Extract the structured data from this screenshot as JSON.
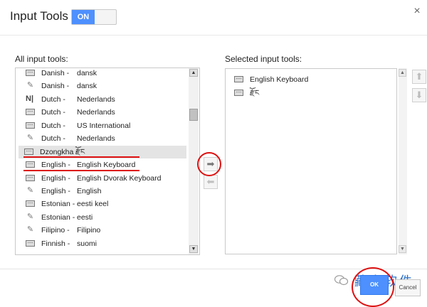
{
  "header": {
    "title": "Input Tools",
    "toggle_label": "ON",
    "close_icon": "×"
  },
  "available": {
    "label": "All input tools:",
    "items": [
      {
        "icon": "keyboard-icon",
        "lang": "Danish -",
        "name": "dansk"
      },
      {
        "icon": "pencil-icon",
        "lang": "Danish -",
        "name": "dansk"
      },
      {
        "icon": "bars-icon",
        "lang": "Dutch -",
        "name": "Nederlands"
      },
      {
        "icon": "keyboard-icon",
        "lang": "Dutch -",
        "name": "Nederlands"
      },
      {
        "icon": "keyboard-icon",
        "lang": "Dutch -",
        "name": "US International"
      },
      {
        "icon": "pencil-icon",
        "lang": "Dutch -",
        "name": "Nederlands"
      },
      {
        "icon": "keyboard-icon",
        "lang": "Dzongkha -",
        "name": "རྫོང"
      },
      {
        "icon": "keyboard-icon",
        "lang": "English -",
        "name": "English Keyboard"
      },
      {
        "icon": "keyboard-icon",
        "lang": "English -",
        "name": "English Dvorak Keyboard"
      },
      {
        "icon": "pencil-icon",
        "lang": "English -",
        "name": "English"
      },
      {
        "icon": "keyboard-icon",
        "lang": "Estonian -",
        "name": "eesti keel"
      },
      {
        "icon": "pencil-icon",
        "lang": "Estonian -",
        "name": "eesti"
      },
      {
        "icon": "pencil-icon",
        "lang": "Filipino -",
        "name": "Filipino"
      },
      {
        "icon": "keyboard-icon",
        "lang": "Finnish -",
        "name": "suomi"
      }
    ]
  },
  "selected": {
    "label": "Selected input tools:",
    "items": [
      {
        "icon": "keyboard-icon",
        "name": "English Keyboard"
      },
      {
        "icon": "keyboard-icon",
        "name": "རྫོང"
      }
    ]
  },
  "controls": {
    "move_right": "➡",
    "move_left": "⬅",
    "move_up": "⬆",
    "move_down": "⬇",
    "scroll_up": "▲",
    "scroll_down": "▼"
  },
  "footer": {
    "ok_label": "OK",
    "cancel_label": "Cancel"
  },
  "watermark": {
    "text": "藏文软件"
  },
  "colors": {
    "toggle_on": "#4d90fe",
    "annotation": "#dd1111",
    "highlight_row": "#e4e4e4"
  }
}
